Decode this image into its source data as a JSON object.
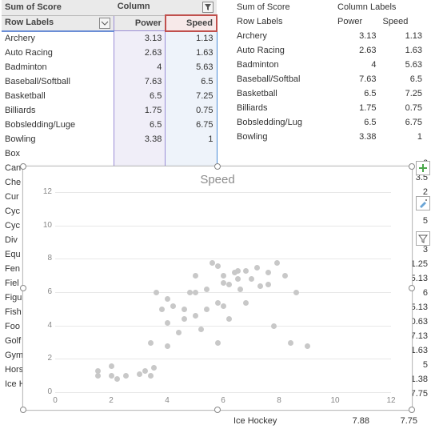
{
  "left_pivot": {
    "corner": "Sum of Score",
    "col_header": "Column",
    "row_header": "Row Labels",
    "power_label": "Power",
    "speed_label": "Speed",
    "rows": [
      {
        "label": "Archery",
        "power": "3.13",
        "speed": "1.13"
      },
      {
        "label": "Auto Racing",
        "power": "2.63",
        "speed": "1.63"
      },
      {
        "label": "Badminton",
        "power": "4",
        "speed": "5.63"
      },
      {
        "label": "Baseball/Softball",
        "power": "7.63",
        "speed": "6.5"
      },
      {
        "label": "Basketball",
        "power": "6.5",
        "speed": "7.25"
      },
      {
        "label": "Billiards",
        "power": "1.75",
        "speed": "0.75"
      },
      {
        "label": "Bobsledding/Luge",
        "power": "6.5",
        "speed": "6.75"
      },
      {
        "label": "Bowling",
        "power": "3.38",
        "speed": "1"
      }
    ],
    "partial_labels": [
      "Box",
      "Can",
      "Che",
      "Cur",
      "Cyc",
      "Cyc",
      "Div",
      "Equ",
      "Fen",
      "Fiel",
      "Figu",
      "Fish",
      "Foo",
      "Golf",
      "Gym",
      "Hors",
      "Ice Hockey"
    ],
    "ice_hockey_power": "7.88",
    "ice_hockey_speed": "7.75"
  },
  "right_pivot": {
    "corner": "Sum of Score",
    "col_header": "Column Labels",
    "row_header": "Row Labels",
    "power_label": "Power",
    "speed_label": "Speed",
    "rows": [
      {
        "label": "Archery",
        "power": "3.13",
        "speed": "1.13"
      },
      {
        "label": "Auto Racing",
        "power": "2.63",
        "speed": "1.63"
      },
      {
        "label": "Badminton",
        "power": "4",
        "speed": "5.63"
      },
      {
        "label": "Baseball/Softbal",
        "power": "7.63",
        "speed": "6.5"
      },
      {
        "label": "Basketball",
        "power": "6.5",
        "speed": "7.25"
      },
      {
        "label": "Billiards",
        "power": "1.75",
        "speed": "0.75"
      },
      {
        "label": "Bobsledding/Lug",
        "power": "6.5",
        "speed": "6.75"
      },
      {
        "label": "Bowling",
        "power": "3.38",
        "speed": "1"
      }
    ],
    "ice_hockey_label": "Ice Hockey",
    "ice_hockey_power": "7.88",
    "ice_hockey_speed": "7.75"
  },
  "edge_values": [
    "6",
    "3.5",
    "2",
    "1.5",
    "5",
    "7.5",
    "3",
    "1.25",
    "5.13",
    "6",
    "5.13",
    "0.63",
    "7.13",
    "1.63",
    "5",
    "1.38",
    "7.75"
  ],
  "chart": {
    "title": "Speed",
    "y_ticks": [
      "0",
      "2",
      "4",
      "6",
      "8",
      "10",
      "12"
    ],
    "x_ticks": [
      "0",
      "2",
      "4",
      "6",
      "8",
      "10",
      "12"
    ]
  },
  "chart_data": {
    "type": "scatter",
    "title": "Speed",
    "xlabel": "",
    "ylabel": "",
    "xlim": [
      0,
      12
    ],
    "ylim": [
      0,
      12
    ],
    "series": [
      {
        "name": "Speed",
        "points": [
          [
            1.5,
            1.0
          ],
          [
            1.5,
            1.3
          ],
          [
            2.0,
            1.0
          ],
          [
            2.0,
            1.6
          ],
          [
            2.2,
            0.8
          ],
          [
            2.5,
            1.0
          ],
          [
            3.0,
            1.1
          ],
          [
            3.2,
            1.3
          ],
          [
            3.4,
            1.0
          ],
          [
            3.4,
            3.0
          ],
          [
            3.5,
            1.5
          ],
          [
            3.6,
            6.0
          ],
          [
            3.8,
            5.0
          ],
          [
            4.0,
            5.6
          ],
          [
            4.0,
            2.8
          ],
          [
            4.0,
            4.2
          ],
          [
            4.2,
            5.2
          ],
          [
            4.4,
            3.6
          ],
          [
            4.6,
            5.0
          ],
          [
            4.6,
            4.4
          ],
          [
            4.8,
            6.0
          ],
          [
            5.0,
            6.0
          ],
          [
            5.0,
            4.6
          ],
          [
            5.0,
            7.0
          ],
          [
            5.2,
            3.8
          ],
          [
            5.4,
            6.2
          ],
          [
            5.4,
            5.0
          ],
          [
            5.6,
            7.8
          ],
          [
            5.8,
            5.4
          ],
          [
            5.8,
            7.6
          ],
          [
            5.8,
            3.0
          ],
          [
            6.0,
            5.2
          ],
          [
            6.0,
            7.0
          ],
          [
            6.0,
            6.6
          ],
          [
            6.2,
            4.4
          ],
          [
            6.2,
            6.5
          ],
          [
            6.4,
            7.2
          ],
          [
            6.5,
            6.8
          ],
          [
            6.5,
            7.3
          ],
          [
            6.6,
            6.2
          ],
          [
            6.8,
            7.3
          ],
          [
            6.8,
            5.4
          ],
          [
            7.0,
            6.8
          ],
          [
            7.2,
            7.5
          ],
          [
            7.3,
            6.4
          ],
          [
            7.6,
            6.5
          ],
          [
            7.6,
            7.2
          ],
          [
            7.8,
            4.0
          ],
          [
            7.9,
            7.8
          ],
          [
            8.2,
            7.0
          ],
          [
            8.4,
            3.0
          ],
          [
            8.6,
            6.0
          ],
          [
            9.0,
            2.8
          ]
        ]
      }
    ]
  }
}
